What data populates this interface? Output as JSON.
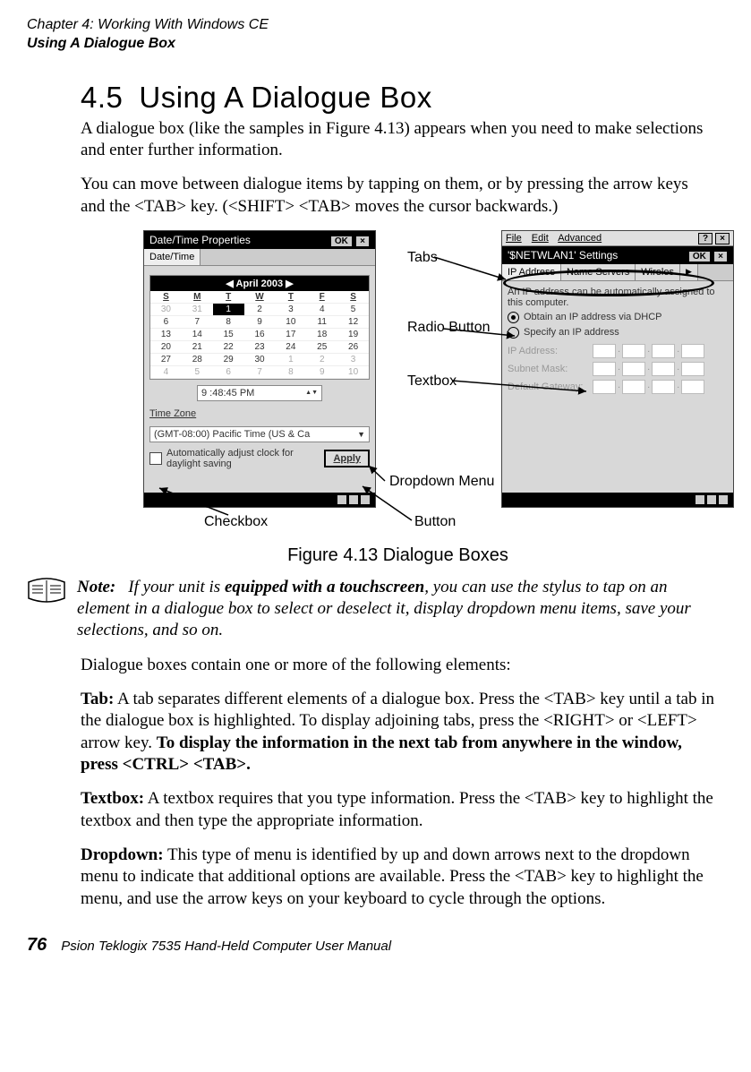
{
  "header": {
    "chapter": "Chapter 4: Working With Windows CE",
    "subject": "Using A Dialogue Box"
  },
  "section": {
    "number": "4.5",
    "title": "Using A Dialogue Box",
    "intro1": "A dialogue box (like the samples in Figure 4.13) appears when you need to make selections and enter further information.",
    "intro2": "You can move between dialogue items by tapping on them, or by pressing the arrow keys and the <TAB> key. (<SHIFT> <TAB> moves the cursor backwards.)"
  },
  "callouts": {
    "tabs": "Tabs",
    "radio": "Radio Button",
    "textbox": "Textbox",
    "dropdown": "Dropdown Menu",
    "button": "Button",
    "checkbox": "Checkbox"
  },
  "left_ss": {
    "title": "Date/Time Properties",
    "tab": "Date/Time",
    "month_label": "April 2003",
    "month_prev": "◀",
    "month_next": "▶",
    "dow": [
      "S",
      "M",
      "T",
      "W",
      "T",
      "F",
      "S"
    ],
    "weeks": [
      [
        "30",
        "31",
        "1",
        "2",
        "3",
        "4",
        "5"
      ],
      [
        "6",
        "7",
        "8",
        "9",
        "10",
        "11",
        "12"
      ],
      [
        "13",
        "14",
        "15",
        "16",
        "17",
        "18",
        "19"
      ],
      [
        "20",
        "21",
        "22",
        "23",
        "24",
        "25",
        "26"
      ],
      [
        "27",
        "28",
        "29",
        "30",
        "1",
        "2",
        "3"
      ],
      [
        "4",
        "5",
        "6",
        "7",
        "8",
        "9",
        "10"
      ]
    ],
    "time_value": "9 :48:45 PM",
    "zone_label": "Time Zone",
    "zone_value": "(GMT-08:00) Pacific Time (US & Ca",
    "chk_label": "Automatically adjust clock for daylight saving",
    "apply": "Apply",
    "ok": "OK",
    "x": "×"
  },
  "right_ss": {
    "menu_file": "File",
    "menu_edit": "Edit",
    "menu_adv": "Advanced",
    "q": "?",
    "x": "×",
    "title": "'$NETWLAN1' Settings",
    "ok": "OK",
    "tab1": "IP Address",
    "tab2": "Name Servers",
    "tab3": "Wireles",
    "desc": "An IP address can be automatically assigned to this computer.",
    "radio1": "Obtain an IP address via DHCP",
    "radio2": "Specify an IP address",
    "ip_label": "IP Address:",
    "mask_label": "Subnet Mask:",
    "gw_label": "Default Gateway:"
  },
  "figure_caption": "Figure 4.13 Dialogue Boxes",
  "note": {
    "label": "Note:",
    "body_prefix": "If your unit is ",
    "body_bold": "equipped with a touchscreen",
    "body_suffix": ", you can use the stylus to tap on an element in a dialogue box to select or deselect it, display dropdown menu items, save your selections, and so on."
  },
  "after_note": "Dialogue boxes contain one or more of the following elements:",
  "defs": {
    "tab_term": "Tab:",
    "tab_body1": " A tab separates different elements of a dialogue box. Press the <TAB> key until a tab in the dialogue box is highlighted. To display adjoining tabs, press the <RIGHT> or <LEFT> arrow key. ",
    "tab_bold": "To display the information in the next tab from anywhere in the window, press <CTRL> <TAB>.",
    "text_term": "Textbox:",
    "text_body": " A textbox requires that you type information. Press the <TAB> key to highlight the textbox and then type the appropriate information.",
    "drop_term": "Dropdown:",
    "drop_body": " This type of menu is identified by up and down arrows next to the dropdown menu to indicate that additional options are available. Press the <TAB> key to highlight the menu, and use the arrow keys on your keyboard to cycle through the options."
  },
  "footer": {
    "page": "76",
    "source": "Psion Teklogix 7535 Hand-Held Computer User Manual"
  }
}
